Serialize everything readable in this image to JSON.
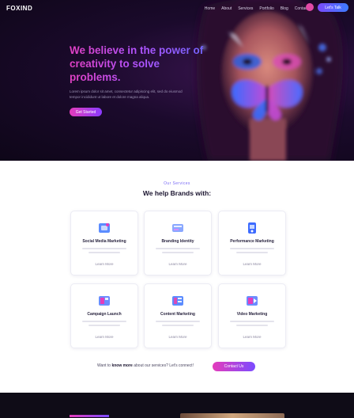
{
  "header": {
    "logo": "FOXIND",
    "nav_items": [
      "Home",
      "About",
      "Services",
      "Portfolio",
      "Blog",
      "Contact"
    ],
    "cta_label": "Let's Talk"
  },
  "hero": {
    "title": "We believe in the power of creativity to solve problems.",
    "subtitle": "Lorem ipsum dolor sit amet, consectetur adipiscing elit, sed do eiusmod tempor incididunt ut labore et dolore magna aliqua.",
    "button_label": "Get Started"
  },
  "services": {
    "eyebrow": "Our Services",
    "title": "We help Brands with:",
    "cards": [
      {
        "title": "Social Media Marketing",
        "desc": "Lorem ipsum dolor sit amet consectetur adipiscing",
        "link": "Learn More",
        "icon": "social-icon"
      },
      {
        "title": "Branding Identity",
        "desc": "Lorem ipsum dolor sit amet consectetur adipiscing",
        "link": "Learn More",
        "icon": "branding-icon"
      },
      {
        "title": "Performance Marketing",
        "desc": "Lorem ipsum dolor sit amet consectetur adipiscing",
        "link": "Learn More",
        "icon": "performance-icon"
      },
      {
        "title": "Campaign Launch",
        "desc": "Lorem ipsum dolor sit amet consectetur adipiscing",
        "link": "Learn More",
        "icon": "campaign-icon"
      },
      {
        "title": "Content Marketing",
        "desc": "Lorem ipsum dolor sit amet consectetur adipiscing",
        "link": "Learn More",
        "icon": "content-icon"
      },
      {
        "title": "Video Marketing",
        "desc": "Lorem ipsum dolor sit amet consectetur adipiscing",
        "link": "Learn More",
        "icon": "video-icon"
      }
    ]
  },
  "cta": {
    "text_before": "Want to",
    "text_bold": "know more",
    "text_after": "about our services? Let's connect!",
    "button_label": "Contact Us"
  },
  "colors": {
    "accent_pink": "#e43cbb",
    "accent_purple": "#7b4bff",
    "hero_bg": "#1b0a2c"
  }
}
